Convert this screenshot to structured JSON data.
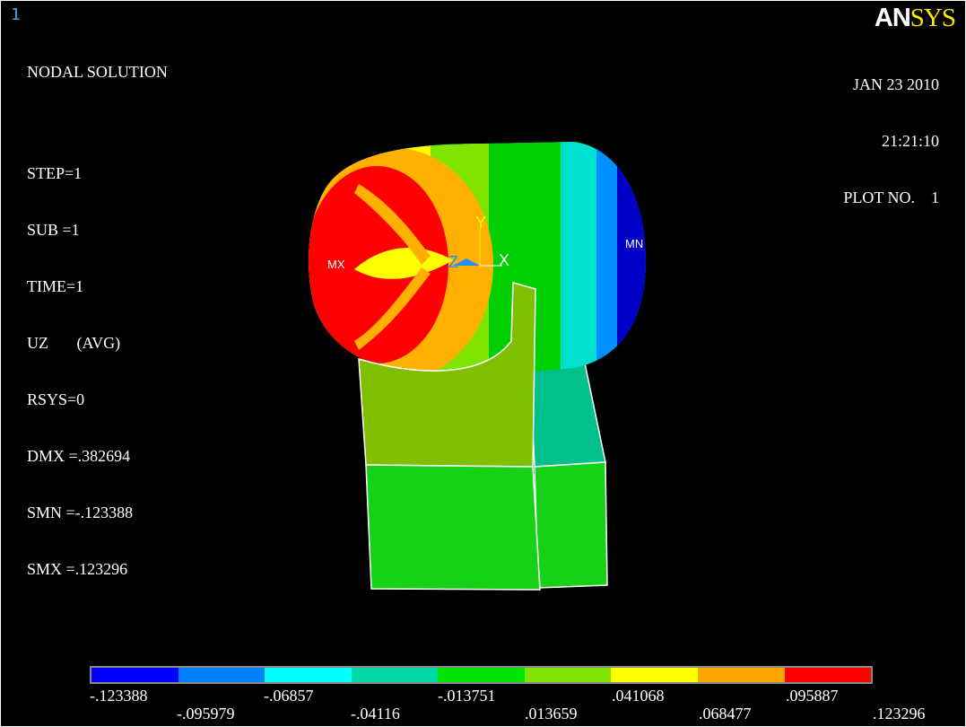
{
  "window_number": "1",
  "info_lines": [
    "NODAL SOLUTION",
    "",
    "STEP=1",
    "SUB =1",
    "TIME=1",
    "UZ       (AVG)",
    "RSYS=0",
    "DMX =.382694",
    "SMN =-.123388",
    "SMX =.123296"
  ],
  "logo": {
    "part1": "AN",
    "part2": "SYS"
  },
  "date_block": {
    "date": "JAN 23 2010",
    "time": "21:21:10",
    "plot": "PLOT NO.    1"
  },
  "markers": {
    "max": "MX",
    "min": "MN"
  },
  "axes": {
    "x": "X",
    "y": "Y",
    "z": "Z"
  },
  "legend": {
    "colors": [
      "#0000ff",
      "#0080ff",
      "#00ffff",
      "#00d9a6",
      "#00e400",
      "#7fe400",
      "#ffff00",
      "#ffa500",
      "#ff0000"
    ],
    "top_labels": [
      "-.123388",
      "-.06857",
      "-.013751",
      ".041068",
      ".095887"
    ],
    "bottom_labels": [
      "-.095979",
      "-.04116",
      ".013659",
      ".068477",
      ".123296"
    ]
  }
}
